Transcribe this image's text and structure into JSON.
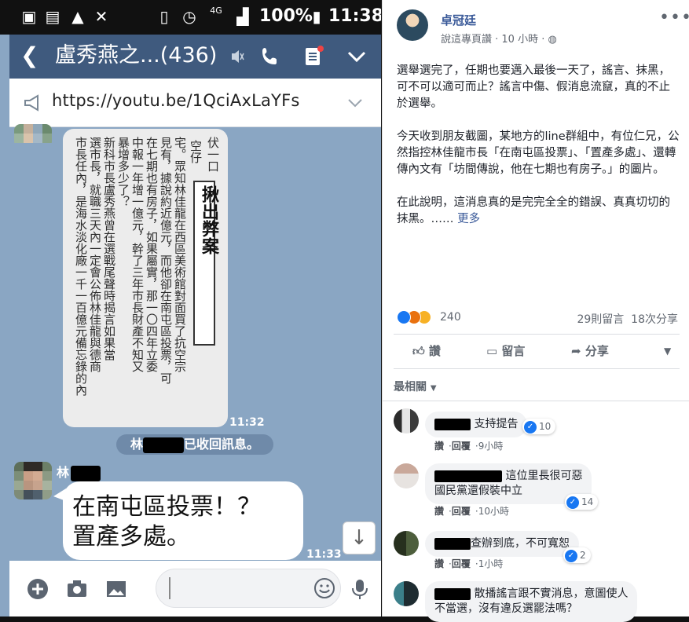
{
  "status_bar": {
    "battery_pct": "100%",
    "time": "11:38",
    "signal_label": "4G"
  },
  "chat_header": {
    "title": "盧秀燕之...(436)"
  },
  "announcement": {
    "url": "https://youtu.be/1QciAxLaYFs"
  },
  "news_image": {
    "headline": "揪出弊案",
    "columns": [
      "伏一口",
      "空仔",
      "宅。眾知林佳龍在西區美術館對面買了抗空宗",
      "見有，據說約近億元，而他卻在南屯區投票，可",
      "在七期也有房子，如果屬實，那一〇四年立委",
      "中報一年增一億元，幹了三年市長財產不知又",
      "暴增多少了？",
      "新科市長盧秀燕曾在選戰尾聲時揭言如果當",
      "選市長，就職三天內一定會公佈林佳龍與德商",
      "市長任內，是海水淡化廠一千一百億元備忘錄的內"
    ],
    "time": "11:32"
  },
  "recall_notice": {
    "prefix": "林",
    "suffix": "已收回訊息。"
  },
  "message": {
    "sender_prefix": "林",
    "text": "在南屯區投票！？\n置產多處。",
    "time": "11:33"
  },
  "input_bar": {
    "placeholder": ""
  },
  "fb_post": {
    "author": "卓冠廷",
    "meta": "說這專頁讚 · 10 小時 ·",
    "paragraphs": [
      "選舉選完了，任期也要邁入最後一天了，謠言、抹黑，可不可以適可而止？謠言中傷、假消息流竄，真的不止於選舉。",
      "今天收到朋友截圖，某地方的line群組中，有位仁兄，公然指控林佳龍市長「在南屯區投票」、「置產多處」、還轉傳內文有「坊間傳說，他在七期也有房子。」的圖片。",
      "在此說明，這消息真的是完完全全的錯誤、真真切切的抹黑。……"
    ],
    "more_link": "更多",
    "reactions_count": "240",
    "comments_count": "29則留言",
    "shares_count": "18次分享",
    "actions": {
      "like": "讚",
      "comment": "留言",
      "share": "分享"
    },
    "sort_label": "最相關",
    "comments": [
      {
        "text": "支持提告",
        "likes": "10",
        "time": "9小時"
      },
      {
        "text": "這位里長很可惡\n國民黨還假裝中立",
        "likes": "14",
        "time": "10小時"
      },
      {
        "text": "查辦到底，不可寬恕",
        "likes": "2",
        "time": "1小時"
      },
      {
        "text": "散播謠言跟不實消息，意圖使人\n不當選，沒有違反選罷法嗎？",
        "likes": "",
        "time": ""
      }
    ],
    "comment_actions": {
      "like": "讚",
      "reply": "回覆"
    }
  },
  "colors": {
    "chat_bg": "#8aa6c3",
    "header_bg": "#3f5a7e",
    "fb_blue": "#385898",
    "like_blue": "#1877f2"
  }
}
